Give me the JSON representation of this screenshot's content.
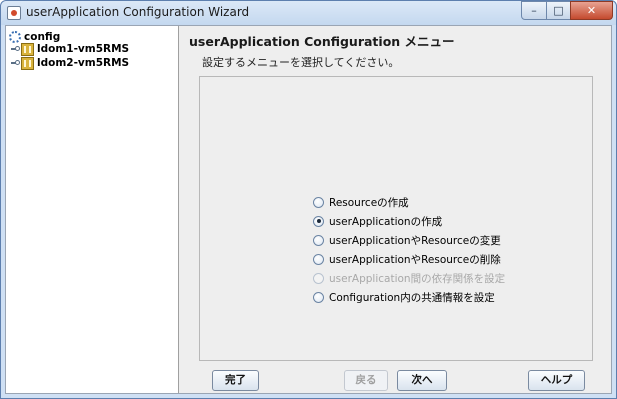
{
  "window": {
    "title": "userApplication Configuration Wizard",
    "controls": {
      "minimize": "–",
      "maximize": "□",
      "close": "✕"
    }
  },
  "tree": {
    "root": {
      "label": "config",
      "icon": "config-root-icon"
    },
    "children": [
      {
        "label": "ldom1-vm5RMS",
        "icon": "node-icon"
      },
      {
        "label": "ldom2-vm5RMS",
        "icon": "node-icon"
      }
    ]
  },
  "main": {
    "heading": "userApplication Configuration メニュー",
    "subtitle": "設定するメニューを選択してください。",
    "options": [
      {
        "label": "Resourceの作成",
        "checked": false,
        "enabled": true
      },
      {
        "label": "userApplicationの作成",
        "checked": true,
        "enabled": true
      },
      {
        "label": "userApplicationやResourceの変更",
        "checked": false,
        "enabled": true
      },
      {
        "label": "userApplicationやResourceの削除",
        "checked": false,
        "enabled": true
      },
      {
        "label": "userApplication間の依存関係を設定",
        "checked": false,
        "enabled": false
      },
      {
        "label": "Configuration内の共通情報を設定",
        "checked": false,
        "enabled": true
      }
    ]
  },
  "buttons": {
    "done": "完了",
    "back": "戻る",
    "next": "次へ",
    "help": "ヘルプ"
  },
  "colors": {
    "titlebar": "#c4d8ef",
    "close_button": "#c44a2e",
    "panel_background": "#eeeeee"
  }
}
